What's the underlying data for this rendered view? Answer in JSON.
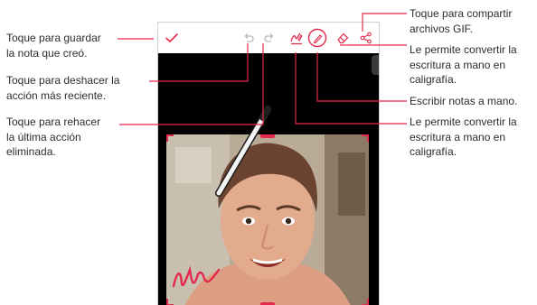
{
  "callouts": {
    "save": "Toque para guardar\nla nota que creó.",
    "undo": "Toque para deshacer la\nacción más reciente.",
    "redo": "Toque para rehacer\nla última acción\neliminada.",
    "share": "Toque para compartir\narchivos GIF.",
    "convert_top": "Le permite convertir la\nescritura a mano en\ncaligrafía.",
    "write": "Escribir notas a mano.",
    "convert_bottom": "Le permite convertir la\nescritura a mano en\ncaligrafía."
  },
  "toolbar_icons": [
    "check-icon",
    "undo-icon",
    "redo-icon",
    "handwriting-convert-icon",
    "pen-icon",
    "eraser-icon",
    "share-icon"
  ],
  "colors": {
    "accent": "#e5284b",
    "callout_line": "#e5284b",
    "toolbar_icon": "#b8b8b8"
  }
}
